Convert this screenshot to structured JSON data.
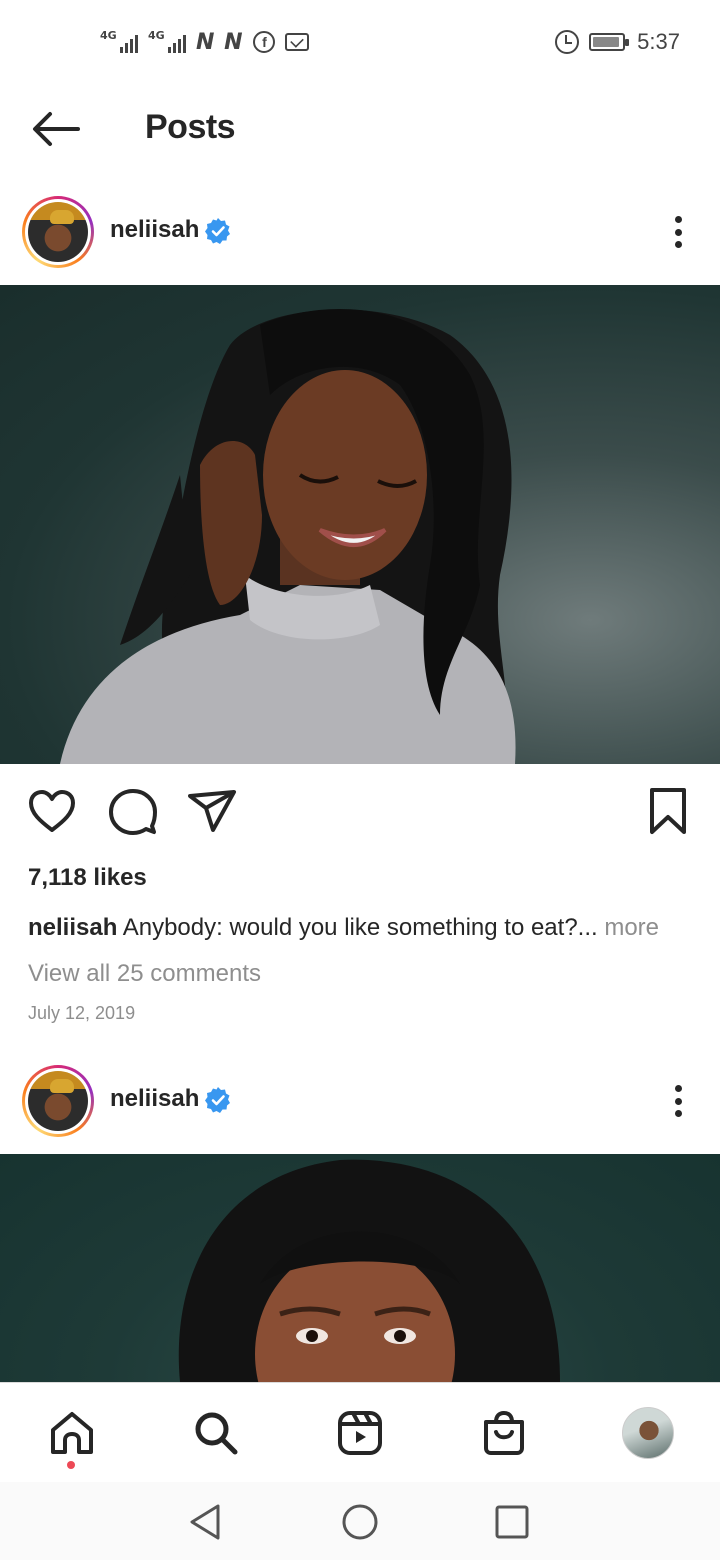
{
  "status_bar": {
    "network1": "4G",
    "network2": "4G",
    "n_badges": "N N",
    "fb": "f",
    "time": "5:37"
  },
  "header": {
    "title": "Posts"
  },
  "posts": [
    {
      "username": "neliisah",
      "likes": "7,118 likes",
      "caption_user": "neliisah",
      "caption_text": "Anybody: would you like something to eat?...",
      "caption_more": "more",
      "comments_link": "View all 25 comments",
      "date": "July 12, 2019"
    },
    {
      "username": "neliisah"
    }
  ],
  "icons": {
    "back": "back-arrow-icon",
    "verified": "verified-badge-icon",
    "more": "more-options-icon",
    "like": "heart-icon",
    "comment": "comment-icon",
    "share": "send-icon",
    "save": "bookmark-icon",
    "home": "home-icon",
    "search": "search-icon",
    "reels": "reels-icon",
    "shop": "shop-icon",
    "profile": "profile-avatar",
    "sys_back": "triangle-back-icon",
    "sys_home": "circle-home-icon",
    "sys_recents": "square-recents-icon"
  },
  "colors": {
    "verified": "#3897f0",
    "notification_dot": "#ed4956",
    "text": "#262626",
    "muted": "#8e8e8e"
  }
}
